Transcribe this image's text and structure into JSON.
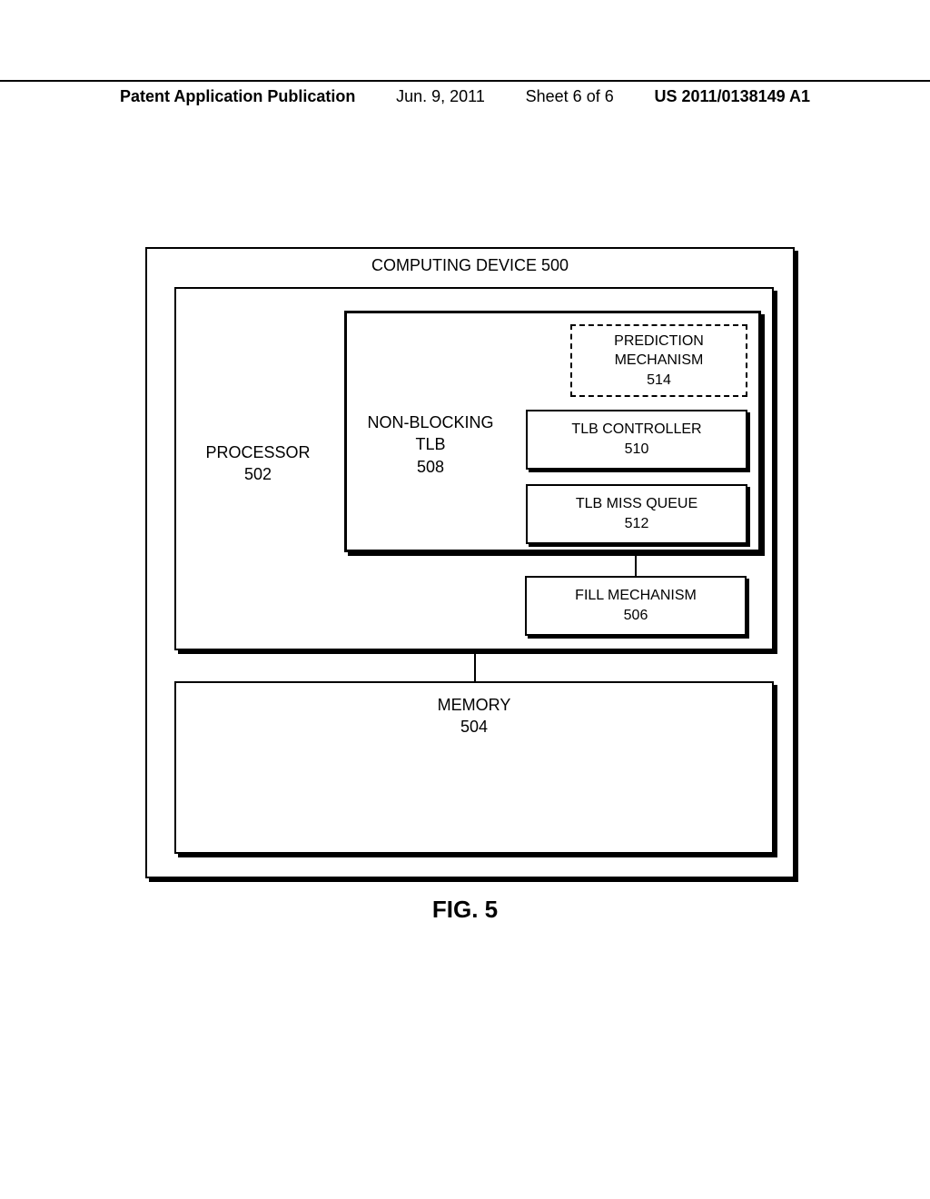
{
  "header": {
    "left": "Patent Application Publication",
    "date": "Jun. 9, 2011",
    "sheet": "Sheet 6 of 6",
    "right": "US 2011/0138149 A1"
  },
  "diagram": {
    "computing_device": "COMPUTING DEVICE 500",
    "processor": "PROCESSOR\n502",
    "non_blocking_tlb": "NON-BLOCKING\nTLB\n508",
    "prediction": "PREDICTION\nMECHANISM\n514",
    "tlb_controller": "TLB CONTROLLER\n510",
    "tlb_miss_queue": "TLB MISS QUEUE\n512",
    "fill_mechanism": "FILL MECHANISM\n506",
    "memory": "MEMORY\n504"
  },
  "caption": "FIG. 5"
}
